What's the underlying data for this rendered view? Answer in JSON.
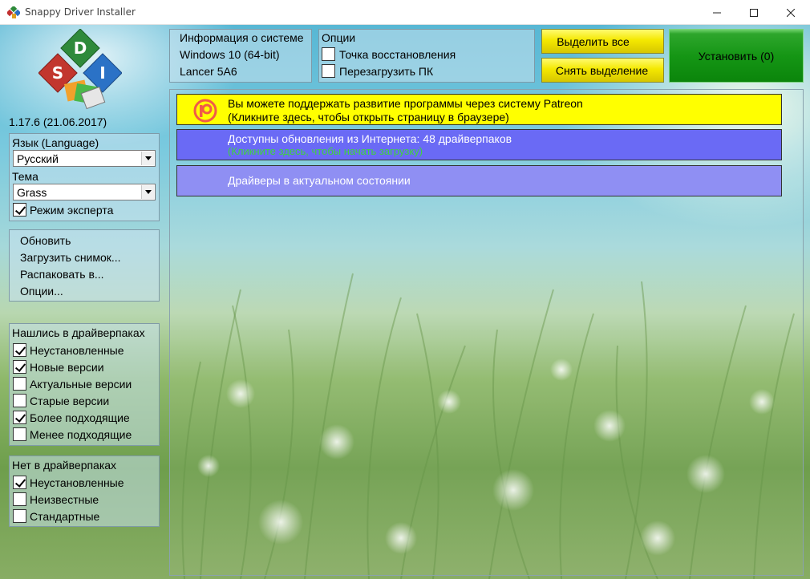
{
  "window": {
    "title": "Snappy Driver Installer"
  },
  "sidebar": {
    "version": "1.17.6 (21.06.2017)",
    "settings": {
      "language_label": "Язык (Language)",
      "language_value": "Русский",
      "theme_label": "Тема",
      "theme_value": "Grass",
      "expert_mode_label": "Режим эксперта",
      "expert_mode_checked": true
    },
    "actions": [
      "Обновить",
      "Загрузить снимок...",
      "Распаковать в...",
      "Опции..."
    ],
    "found_filter": {
      "title": "Нашлись в драйверпаках",
      "items": [
        {
          "label": "Неустановленные",
          "checked": true
        },
        {
          "label": "Новые версии",
          "checked": true
        },
        {
          "label": "Актуальные версии",
          "checked": false
        },
        {
          "label": "Старые версии",
          "checked": false
        },
        {
          "label": "Более подходящие",
          "checked": true
        },
        {
          "label": "Менее подходящие",
          "checked": false
        }
      ]
    },
    "notfound_filter": {
      "title": "Нет в драйверпаках",
      "items": [
        {
          "label": "Неустановленные",
          "checked": true
        },
        {
          "label": "Неизвестные",
          "checked": false
        },
        {
          "label": "Стандартные",
          "checked": false
        }
      ]
    }
  },
  "sysinfo": {
    "title": "Информация о системе",
    "os": "Windows 10 (64-bit)",
    "model": "Lancer 5A6"
  },
  "options": {
    "title": "Опции",
    "items": [
      {
        "label": "Точка восстановления",
        "checked": false
      },
      {
        "label": "Перезагрузить ПК",
        "checked": false
      }
    ]
  },
  "buttons": {
    "select_all": "Выделить все",
    "deselect": "Снять выделение",
    "install": "Установить (0)"
  },
  "messages": {
    "patreon_line1": "Вы можете поддержать развитие программы через систему Patreon",
    "patreon_line2": "(Кликните здесь, чтобы открыть страницу в браузере)",
    "updates_line1": "Доступны обновления из Интернета: 48 драйверпаков",
    "updates_line2": "(Кликните здесь, чтобы начать загрузку)",
    "uptodate": "Драйверы в актуальном состоянии"
  },
  "colors": {
    "patreon_bg": "#ffff00",
    "updates_bg": "#6a6af5",
    "uptodate_bg": "#8f8ff3",
    "install_bg": "#159615",
    "updates_link": "#3fd23f"
  }
}
